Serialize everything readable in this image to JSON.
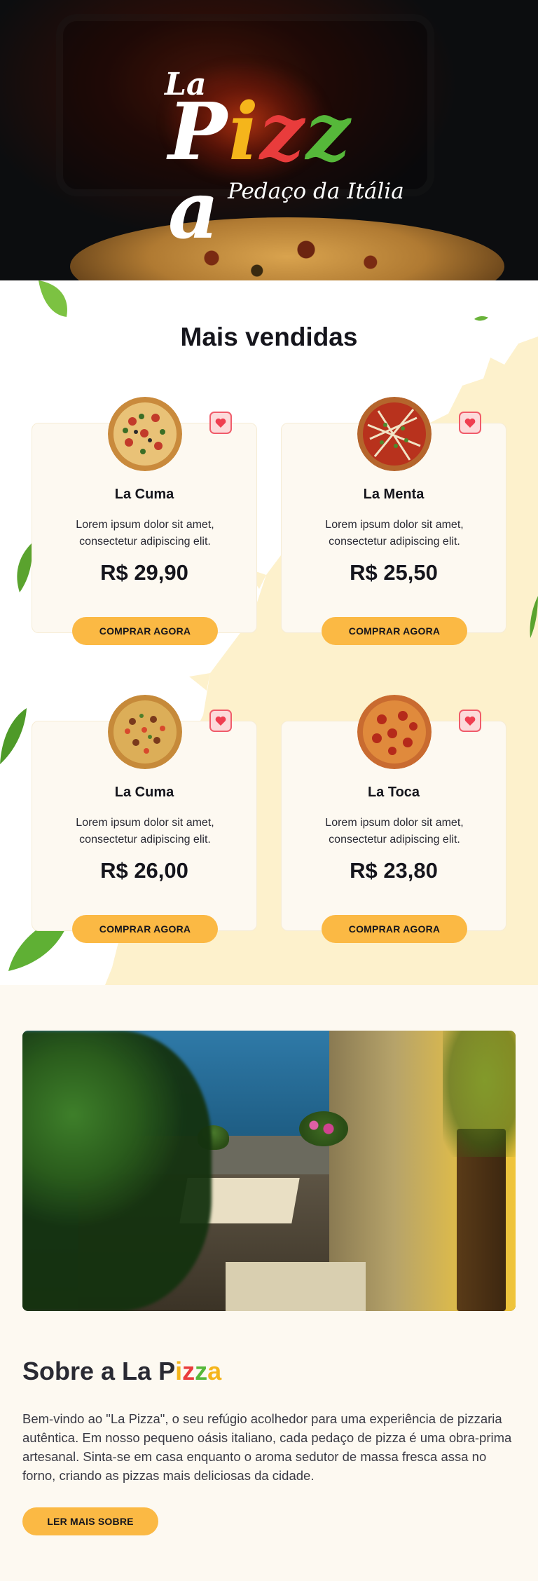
{
  "hero": {
    "logo_la": "La",
    "logo_letters": [
      {
        "char": "P",
        "color": "#ffffff"
      },
      {
        "char": "i",
        "color": "#f5b51b"
      },
      {
        "char": "z",
        "color": "#e93c3c"
      },
      {
        "char": "z",
        "color": "#56b83a"
      },
      {
        "char": "a",
        "color": "#ffffff"
      }
    ],
    "tagline": "Pedaço da Itália"
  },
  "sellers": {
    "title": "Mais vendidas",
    "products": [
      {
        "name": "La Cuma",
        "description": "Lorem ipsum dolor sit amet, consectetur adipiscing elit.",
        "price": "R$ 29,90",
        "button": "COMPRAR AGORA"
      },
      {
        "name": "La Menta",
        "description": "Lorem ipsum dolor sit amet, consectetur adipiscing elit.",
        "price": "R$ 25,50",
        "button": "COMPRAR AGORA"
      },
      {
        "name": "La Cuma",
        "description": "Lorem ipsum dolor sit amet, consectetur adipiscing elit.",
        "price": "R$ 26,00",
        "button": "COMPRAR AGORA"
      },
      {
        "name": "La Toca",
        "description": "Lorem ipsum dolor sit amet, consectetur adipiscing elit.",
        "price": "R$ 23,80",
        "button": "COMPRAR AGORA"
      }
    ]
  },
  "about": {
    "title_prefix": "Sobre a La ",
    "title_letters": [
      {
        "char": "P",
        "color": "#2a2a33"
      },
      {
        "char": "i",
        "color": "#f5b51b"
      },
      {
        "char": "z",
        "color": "#e93c3c"
      },
      {
        "char": "z",
        "color": "#56b83a"
      },
      {
        "char": "a",
        "color": "#f5b51b"
      }
    ],
    "text": "Bem-vindo ao \"La Pizza\", o seu refúgio acolhedor para uma experiência de pizzaria autêntica. Em nosso pequeno oásis italiano, cada pedaço de pizza é uma obra-prima artesanal. Sinta-se em casa enquanto o aroma sedutor de massa fresca assa no forno, criando as pizzas mais deliciosas da cidade.",
    "button": "LER MAIS SOBRE"
  },
  "colors": {
    "accent": "#fbb944",
    "heart": "#f05c6a",
    "card_bg": "#fdf9f1"
  }
}
